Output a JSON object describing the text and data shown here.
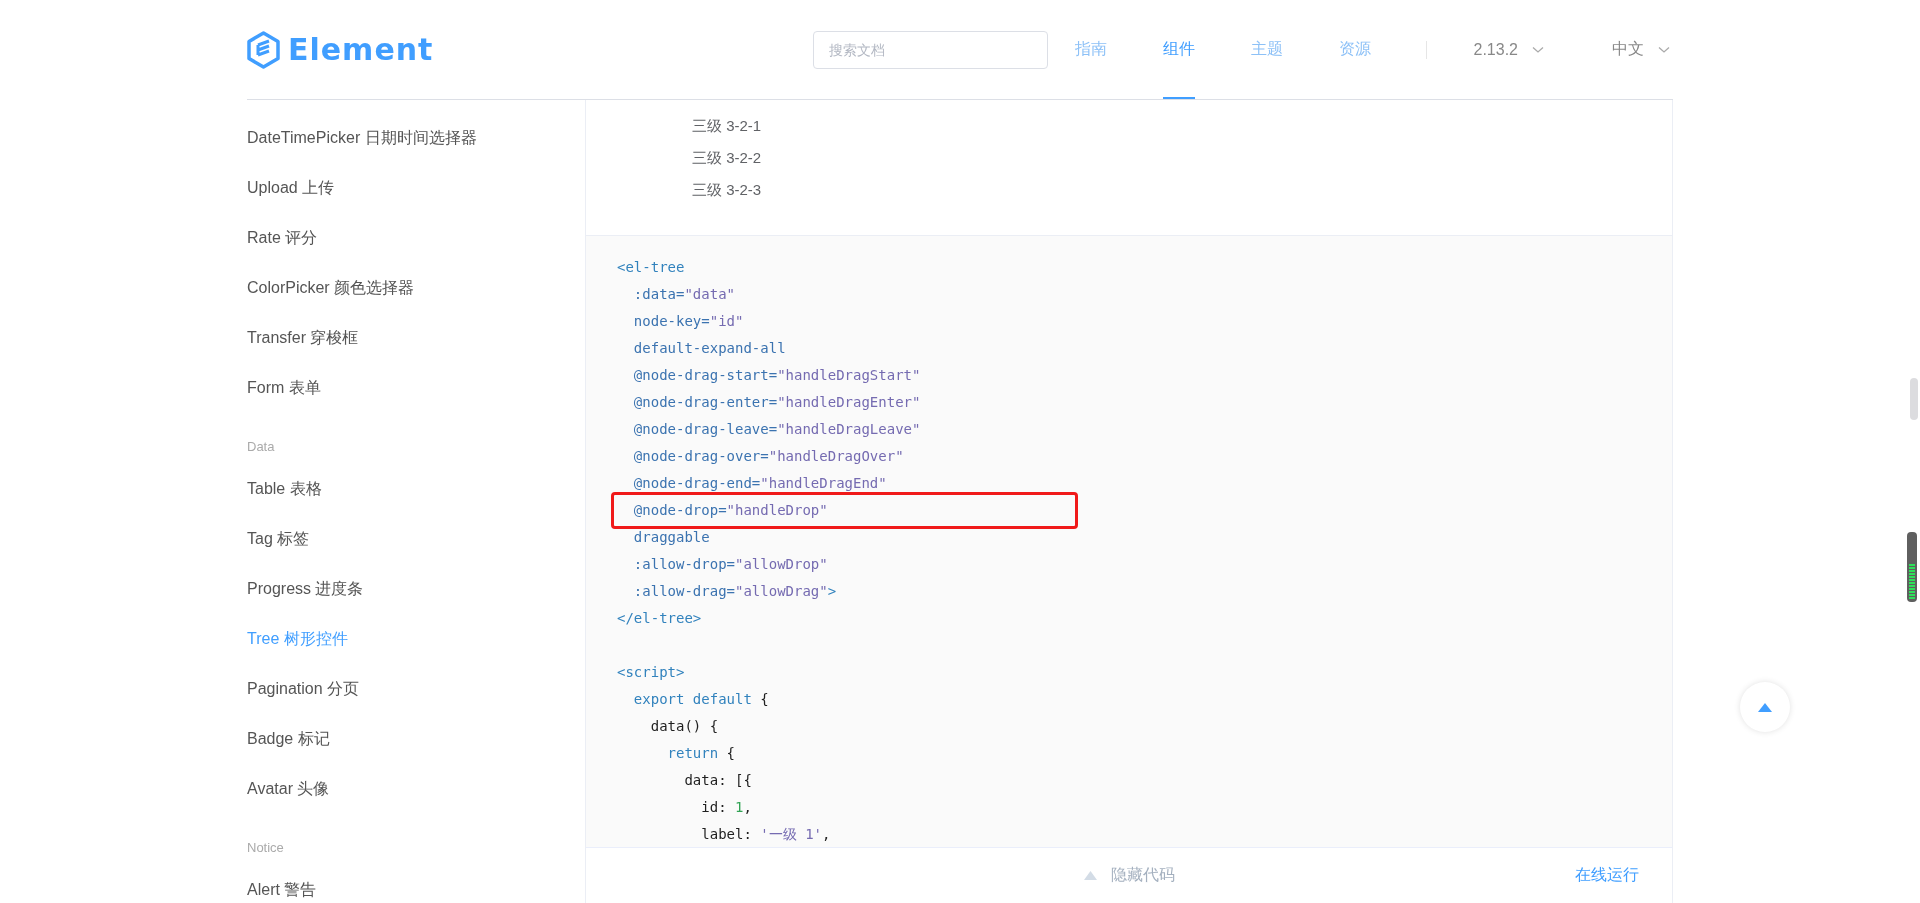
{
  "header": {
    "logo": "Element",
    "search": {
      "placeholder": "搜索文档"
    },
    "nav": [
      {
        "label": "指南",
        "selected": false
      },
      {
        "label": "组件",
        "selected": true
      },
      {
        "label": "主题",
        "selected": false
      },
      {
        "label": "资源",
        "selected": false
      }
    ],
    "version": "2.13.2",
    "language": "中文"
  },
  "sidebar": {
    "sections": [
      {
        "items": [
          {
            "label": "DateTimePicker 日期时间选择器",
            "selected": false
          },
          {
            "label": "Upload 上传",
            "selected": false
          },
          {
            "label": "Rate 评分",
            "selected": false
          },
          {
            "label": "ColorPicker 颜色选择器",
            "selected": false
          },
          {
            "label": "Transfer 穿梭框",
            "selected": false
          },
          {
            "label": "Form 表单",
            "selected": false
          }
        ]
      },
      {
        "title": "Data",
        "items": [
          {
            "label": "Table 表格",
            "selected": false
          },
          {
            "label": "Tag 标签",
            "selected": false
          },
          {
            "label": "Progress 进度条",
            "selected": false
          },
          {
            "label": "Tree 树形控件",
            "selected": true
          },
          {
            "label": "Pagination 分页",
            "selected": false
          },
          {
            "label": "Badge 标记",
            "selected": false
          },
          {
            "label": "Avatar 头像",
            "selected": false
          }
        ]
      },
      {
        "title": "Notice",
        "items": [
          {
            "label": "Alert 警告",
            "selected": false
          }
        ]
      }
    ]
  },
  "demo": {
    "tree_nodes": [
      "三级 3-2-1",
      "三级 3-2-2",
      "三级 3-2-3"
    ],
    "code": {
      "blocks": [
        {
          "lines": [
            {
              "highlighted": false,
              "tokens": [
                {
                  "kind": "tag",
                  "text": "<el-tree"
                }
              ]
            },
            {
              "highlighted": false,
              "tokens": [
                {
                  "kind": "attr",
                  "text": "  :data="
                },
                {
                  "kind": "string",
                  "text": "\"data\""
                }
              ]
            },
            {
              "highlighted": false,
              "tokens": [
                {
                  "kind": "attr",
                  "text": "  node-key="
                },
                {
                  "kind": "string",
                  "text": "\"id\""
                }
              ]
            },
            {
              "highlighted": false,
              "tokens": [
                {
                  "kind": "attr",
                  "text": "  default-expand-all"
                }
              ]
            },
            {
              "highlighted": false,
              "tokens": [
                {
                  "kind": "attr",
                  "text": "  @node-drag-start="
                },
                {
                  "kind": "string",
                  "text": "\"handleDragStart\""
                }
              ]
            },
            {
              "highlighted": false,
              "tokens": [
                {
                  "kind": "attr",
                  "text": "  @node-drag-enter="
                },
                {
                  "kind": "string",
                  "text": "\"handleDragEnter\""
                }
              ]
            },
            {
              "highlighted": false,
              "tokens": [
                {
                  "kind": "attr",
                  "text": "  @node-drag-leave="
                },
                {
                  "kind": "string",
                  "text": "\"handleDragLeave\""
                }
              ]
            },
            {
              "highlighted": false,
              "tokens": [
                {
                  "kind": "attr",
                  "text": "  @node-drag-over="
                },
                {
                  "kind": "string",
                  "text": "\"handleDragOver\""
                }
              ]
            },
            {
              "highlighted": false,
              "tokens": [
                {
                  "kind": "attr",
                  "text": "  @node-drag-end="
                },
                {
                  "kind": "string",
                  "text": "\"handleDragEnd\""
                }
              ]
            },
            {
              "highlighted": true,
              "tokens": [
                {
                  "kind": "attr",
                  "text": "  @node-drop="
                },
                {
                  "kind": "string",
                  "text": "\"handleDrop\""
                }
              ]
            },
            {
              "highlighted": false,
              "tokens": [
                {
                  "kind": "attr",
                  "text": "  draggable"
                }
              ]
            },
            {
              "highlighted": false,
              "tokens": [
                {
                  "kind": "attr",
                  "text": "  :allow-drop="
                },
                {
                  "kind": "string",
                  "text": "\"allowDrop\""
                }
              ]
            },
            {
              "highlighted": false,
              "tokens": [
                {
                  "kind": "attr",
                  "text": "  :allow-drag="
                },
                {
                  "kind": "string",
                  "text": "\"allowDrag\""
                },
                {
                  "kind": "tag",
                  "text": ">"
                }
              ]
            },
            {
              "highlighted": false,
              "tokens": [
                {
                  "kind": "tag",
                  "text": "</el-tree>"
                }
              ]
            }
          ]
        },
        {
          "lines": [
            {
              "highlighted": false,
              "tokens": [
                {
                  "kind": "tag",
                  "text": "<script>"
                }
              ]
            },
            {
              "highlighted": false,
              "tokens": [
                {
                  "kind": "keyword",
                  "text": "  export default"
                },
                {
                  "kind": "plain",
                  "text": " {"
                }
              ]
            },
            {
              "highlighted": false,
              "tokens": [
                {
                  "kind": "plain",
                  "text": "    data() {"
                }
              ]
            },
            {
              "highlighted": false,
              "tokens": [
                {
                  "kind": "keyword",
                  "text": "      return"
                },
                {
                  "kind": "plain",
                  "text": " {"
                }
              ]
            },
            {
              "highlighted": false,
              "tokens": [
                {
                  "kind": "plain",
                  "text": "        data: [{"
                }
              ]
            },
            {
              "highlighted": false,
              "tokens": [
                {
                  "kind": "plain",
                  "text": "          id: "
                },
                {
                  "kind": "number",
                  "text": "1"
                },
                {
                  "kind": "plain",
                  "text": ","
                }
              ]
            },
            {
              "highlighted": false,
              "tokens": [
                {
                  "kind": "plain",
                  "text": "          label: "
                },
                {
                  "kind": "string",
                  "text": "'一级 1'"
                },
                {
                  "kind": "plain",
                  "text": ","
                }
              ]
            }
          ]
        }
      ]
    },
    "footer": {
      "toggle": "隐藏代码",
      "run": "在线运行"
    }
  }
}
